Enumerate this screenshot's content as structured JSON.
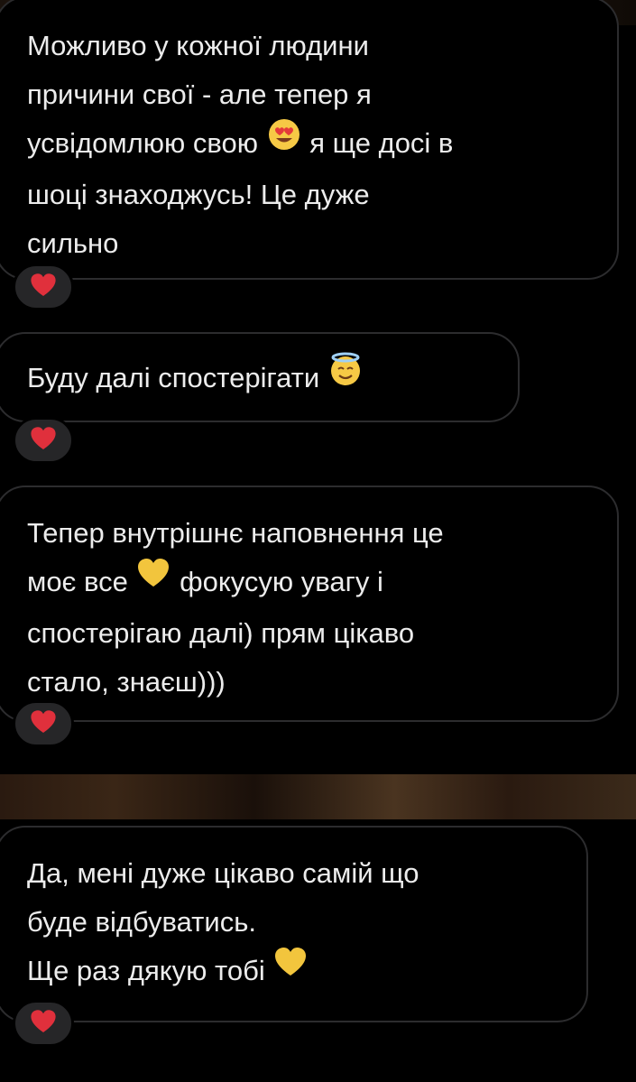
{
  "messages": [
    {
      "lines": [
        [
          "Можливо у кожної людини"
        ],
        [
          "причини свої - але тепер я"
        ],
        [
          "усвідомлюю свою ",
          {
            "icon": "heart-eyes-icon"
          },
          " я ще досі в"
        ],
        [
          "шоці знаходжусь! Це дуже"
        ],
        [
          "сильно"
        ]
      ],
      "reaction": {
        "icon": "red-heart-icon"
      }
    },
    {
      "lines": [
        [
          "Буду далі спостерігати ",
          {
            "icon": "halo-smile-icon"
          }
        ]
      ],
      "reaction": {
        "icon": "red-heart-icon"
      }
    },
    {
      "lines": [
        [
          "Тепер внутрішнє наповнення це"
        ],
        [
          "моє все ",
          {
            "icon": "yellow-heart-icon"
          },
          " фокусую увагу і"
        ],
        [
          "спостерігаю далі) прям цікаво"
        ],
        [
          "стало, знаєш)))"
        ]
      ],
      "reaction": {
        "icon": "red-heart-icon"
      }
    },
    {
      "lines": [
        [
          "Да, мені дуже цікаво самій що"
        ],
        [
          "буде відбуватись."
        ],
        [
          "Ще раз дякую тобі ",
          {
            "icon": "yellow-heart-icon"
          }
        ]
      ],
      "reaction": {
        "icon": "red-heart-icon"
      }
    }
  ],
  "colors": {
    "background": "#000000",
    "bubble_border": "#2c2c2e",
    "text": "#ececec",
    "reaction_bg": "#262628",
    "red_heart": "#e0303c",
    "yellow_heart": "#f2c53d"
  }
}
